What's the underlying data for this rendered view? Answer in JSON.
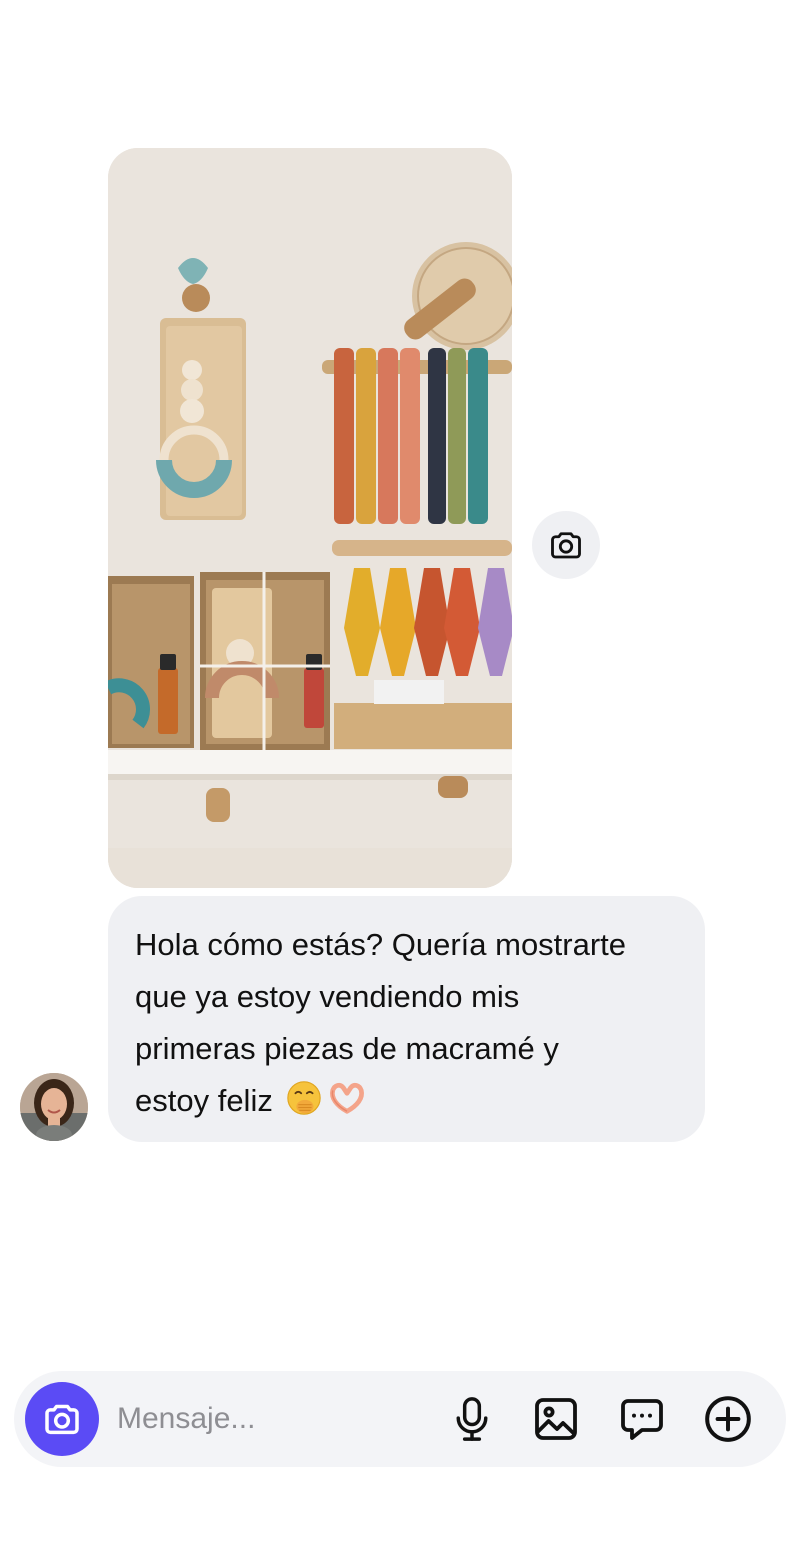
{
  "thread": {
    "photo_message": {
      "alt_icon": "photo"
    },
    "photo_reply_button": {
      "icon": "camera-icon"
    },
    "text_message": {
      "lines": [
        "Hola cómo estás? Quería mostrarte",
        "que ya estoy vendiendo mis",
        "primeras piezas de macramé y",
        "estoy feliz"
      ],
      "emojis": [
        "face-with-hand-over-mouth",
        "heart-hands"
      ]
    },
    "sender_avatar": {
      "icon": "avatar"
    }
  },
  "composer": {
    "placeholder": "Mensaje...",
    "value": "",
    "camera_icon": "camera-icon",
    "buttons": [
      {
        "icon": "microphone-icon"
      },
      {
        "icon": "gallery-icon"
      },
      {
        "icon": "sticker-chat-icon"
      },
      {
        "icon": "plus-circle-icon"
      }
    ]
  },
  "colors": {
    "accent": "#5b4bf5",
    "bubble": "#eff0f3",
    "composer_bg": "#f3f4f7",
    "text": "#111111",
    "placeholder": "#8e8e93"
  }
}
